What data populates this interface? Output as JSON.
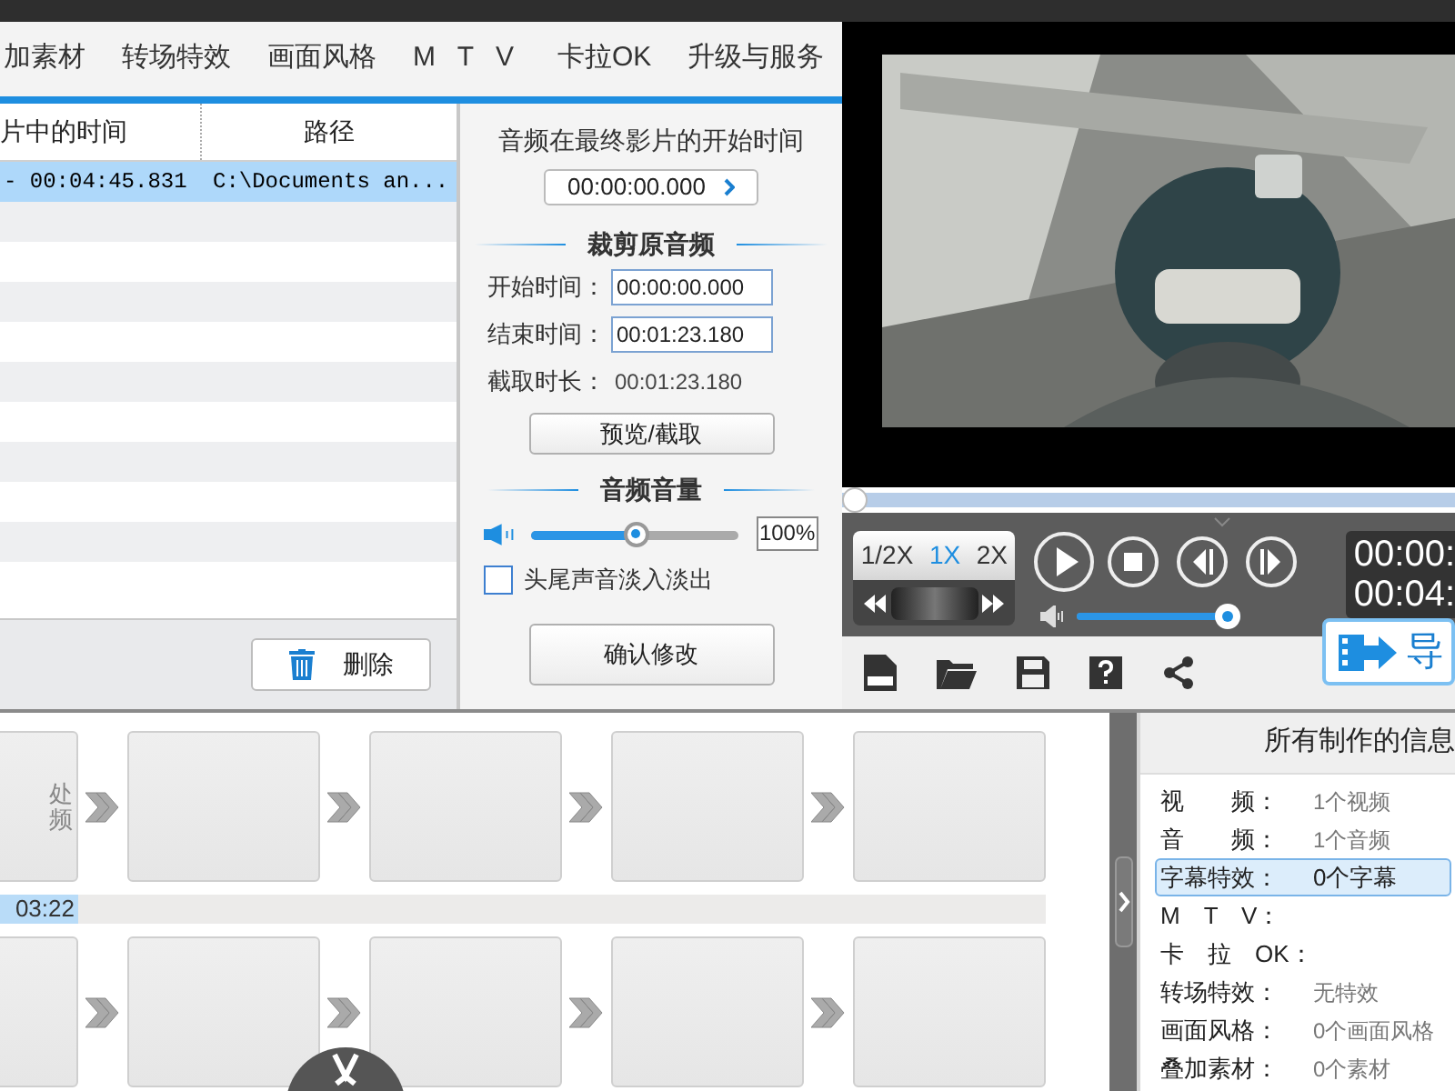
{
  "tabs": [
    {
      "label": "加素材",
      "selected": false
    },
    {
      "label": "转场特效",
      "selected": false
    },
    {
      "label": "画面风格",
      "selected": false
    },
    {
      "label": "M T V",
      "selected": false
    },
    {
      "label": "卡拉OK",
      "selected": false
    },
    {
      "label": "升级与服务",
      "selected": false
    }
  ],
  "audio_list": {
    "columns": [
      "片中的时间",
      "路径"
    ],
    "rows": [
      {
        "cells": [
          "- 00:04:45.831",
          "C:\\Documents an..."
        ],
        "selected": true
      }
    ],
    "delete_button": "删除"
  },
  "audio_settings": {
    "start_in_movie_label": "音频在最终影片的开始时间",
    "start_in_movie": "00:00:00.000",
    "trim_heading": "裁剪原音频",
    "fields": [
      {
        "label": "开始时间：",
        "value": "00:00:00.000",
        "kind": "input"
      },
      {
        "label": "结束时间：",
        "value": "00:01:23.180",
        "kind": "input"
      },
      {
        "label": "截取时长：",
        "value": "00:01:23.180",
        "kind": "text"
      }
    ],
    "preview_button": "预览/截取",
    "volume_heading": "音频音量",
    "volume": {
      "level": 0.51,
      "reading": "100%"
    },
    "fade": {
      "label": "头尾声音淡入淡出",
      "checked": false
    },
    "confirm_button": "确认修改"
  },
  "player": {
    "video": {
      "kind": "picture"
    },
    "seek": {
      "level": 0
    },
    "speeds": [
      {
        "label": "1/2X",
        "selected": false
      },
      {
        "label": "1X",
        "selected": true
      },
      {
        "label": "2X",
        "selected": false
      }
    ],
    "volume": {
      "level": 1
    },
    "times": [
      "00:00:",
      "00:04:"
    ],
    "export_button": "导"
  },
  "timeline": {
    "hint_lines": [
      "处",
      "频"
    ],
    "time_label": "03:22"
  },
  "info_panel": {
    "title": "所有制作的信息",
    "items": [
      {
        "label": "视　　频：",
        "value": "1个视频",
        "selected": false
      },
      {
        "label": "音　　频：",
        "value": "1个音频",
        "selected": false
      },
      {
        "label": "字幕特效：",
        "value": "0个字幕",
        "selected": true
      },
      {
        "label": "M　T　V：",
        "selected": false
      },
      {
        "label": "卡　拉　OK：",
        "selected": false
      },
      {
        "label": "转场特效：",
        "value": "无特效",
        "selected": false
      },
      {
        "label": "画面风格：",
        "value": "0个画面风格",
        "selected": false
      },
      {
        "label": "叠加素材：",
        "value": "0个素材",
        "selected": false
      }
    ]
  }
}
